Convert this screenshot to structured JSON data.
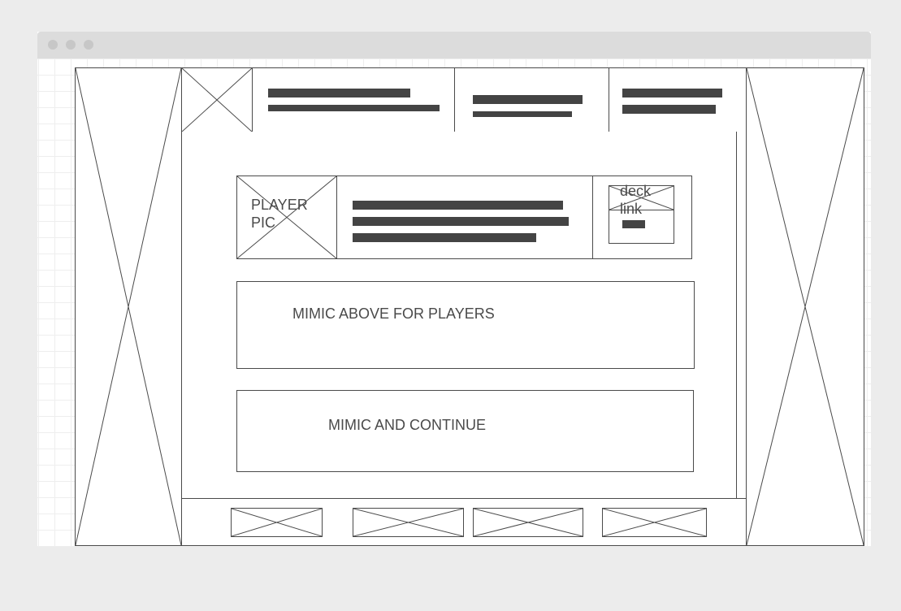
{
  "player_card": {
    "pic_label_line1": "PLAYER",
    "pic_label_line2": "PIC",
    "deck_link_line1": "deck",
    "deck_link_line2": "link"
  },
  "sections": {
    "players_note": "MIMIC ABOVE FOR PLAYERS",
    "continue_note": "MIMIC AND CONTINUE"
  },
  "icons": {
    "window_controls": [
      "close-dot",
      "minimize-dot",
      "zoom-dot"
    ],
    "placeholder": "image-placeholder-icon"
  },
  "colors": {
    "stroke": "#4a4a4a",
    "text_bar": "#444444",
    "window_chrome": "#dcdcdc",
    "backdrop": "#ececec"
  }
}
